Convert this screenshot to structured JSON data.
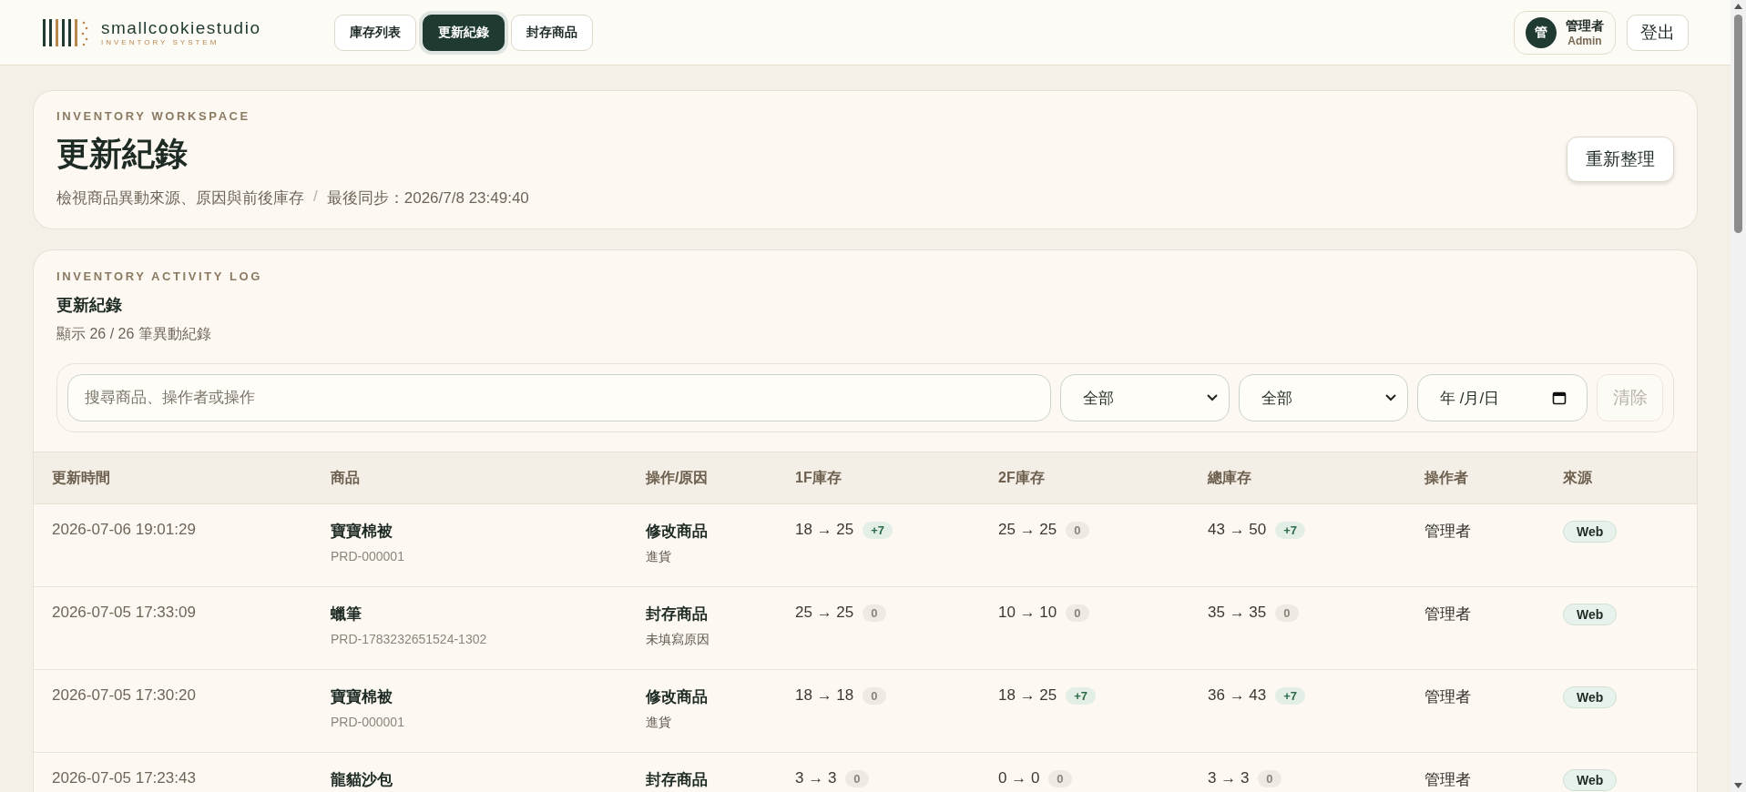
{
  "brand": {
    "name": "smallcookiestudio",
    "tagline": "INVENTORY SYSTEM"
  },
  "nav": [
    {
      "label": "庫存列表",
      "selected": false
    },
    {
      "label": "更新紀錄",
      "selected": true
    },
    {
      "label": "封存商品",
      "selected": false
    }
  ],
  "user": {
    "avatar": "管",
    "name": "管理者",
    "role": "Admin"
  },
  "logout": "登出",
  "workspace": {
    "eyebrow": "INVENTORY WORKSPACE",
    "title": "更新紀錄",
    "subtitle": "檢視商品異動來源、原因與前後庫存",
    "separator": "/",
    "sync": "最後同步：2026/7/8 23:49:40",
    "refresh": "重新整理"
  },
  "log": {
    "eyebrow": "INVENTORY ACTIVITY LOG",
    "title": "更新紀錄",
    "count": "顯示 26 / 26 筆異動紀錄"
  },
  "filters": {
    "search_placeholder": "搜尋商品、操作者或操作",
    "select_1": "全部",
    "select_2": "全部",
    "date": "年 /月/日",
    "clear": "清除"
  },
  "table": {
    "columns": [
      "更新時間",
      "商品",
      "操作/原因",
      "1F庫存",
      "2F庫存",
      "總庫存",
      "操作者",
      "來源"
    ],
    "rows": [
      {
        "time": "2026-07-06 19:01:29",
        "product": "寶寶棉被",
        "code": "PRD-000001",
        "action": "修改商品",
        "reason": "進貨",
        "f1": "18 → 25",
        "f1_delta": {
          "text": "+7",
          "kind": "up"
        },
        "f2": "25 → 25",
        "f2_delta": {
          "text": "0",
          "kind": "zero"
        },
        "total": "43 → 50",
        "total_delta": {
          "text": "+7",
          "kind": "up"
        },
        "operator": "管理者",
        "source": "Web"
      },
      {
        "time": "2026-07-05 17:33:09",
        "product": "蠟筆",
        "code": "PRD-1783232651524-1302",
        "action": "封存商品",
        "reason": "未填寫原因",
        "f1": "25 → 25",
        "f1_delta": {
          "text": "0",
          "kind": "zero"
        },
        "f2": "10 → 10",
        "f2_delta": {
          "text": "0",
          "kind": "zero"
        },
        "total": "35 → 35",
        "total_delta": {
          "text": "0",
          "kind": "zero"
        },
        "operator": "管理者",
        "source": "Web"
      },
      {
        "time": "2026-07-05 17:30:20",
        "product": "寶寶棉被",
        "code": "PRD-000001",
        "action": "修改商品",
        "reason": "進貨",
        "f1": "18 → 18",
        "f1_delta": {
          "text": "0",
          "kind": "zero"
        },
        "f2": "18 → 25",
        "f2_delta": {
          "text": "+7",
          "kind": "up"
        },
        "total": "36 → 43",
        "total_delta": {
          "text": "+7",
          "kind": "up"
        },
        "operator": "管理者",
        "source": "Web"
      },
      {
        "time": "2026-07-05 17:23:43",
        "product": "龍貓沙包",
        "action": "封存商品",
        "f1": "3 → 3",
        "f1_delta": {
          "text": "0",
          "kind": "zero"
        },
        "f2": "0 → 0",
        "f2_delta": {
          "text": "0",
          "kind": "zero"
        },
        "total": "3 → 3",
        "total_delta": {
          "text": "0",
          "kind": "zero"
        },
        "operator": "管理者",
        "source": "Web"
      }
    ]
  }
}
